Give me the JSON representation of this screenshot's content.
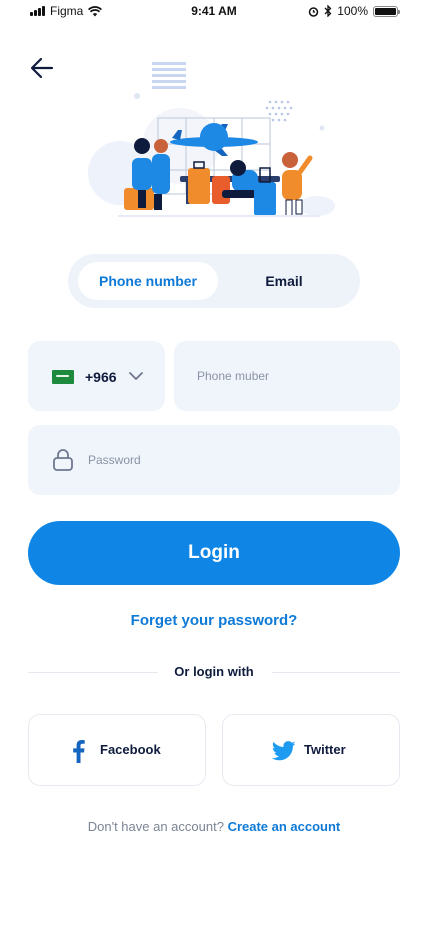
{
  "status_bar": {
    "carrier": "Figma",
    "time": "9:41 AM",
    "battery": "100%",
    "battery_level": 1.0,
    "icons": [
      "signal-icon",
      "wifi-icon",
      "alarm-icon",
      "bluetooth-icon",
      "battery-icon"
    ]
  },
  "nav": {
    "back_icon": "arrow-left-icon"
  },
  "tabs": [
    {
      "label": "Phone number",
      "active": true
    },
    {
      "label": "Email",
      "active": false
    }
  ],
  "phone": {
    "country_code": "+966",
    "flag_icon": "saudi-flag-icon",
    "placeholder": "Phone muber"
  },
  "password": {
    "placeholder": "Password",
    "icon": "lock-icon"
  },
  "login_button": "Login",
  "forgot_link": "Forget your password?",
  "divider_text": "Or login with",
  "social": {
    "facebook": "Facebook",
    "twitter": "Twitter"
  },
  "footer": {
    "prompt": "Don't have an account?",
    "link": "Create an account"
  },
  "colors": {
    "primary": "#0f86e6",
    "link": "#0f7ad6",
    "text_dark": "#0f1b3d",
    "field_bg": "#f0f5fb"
  }
}
